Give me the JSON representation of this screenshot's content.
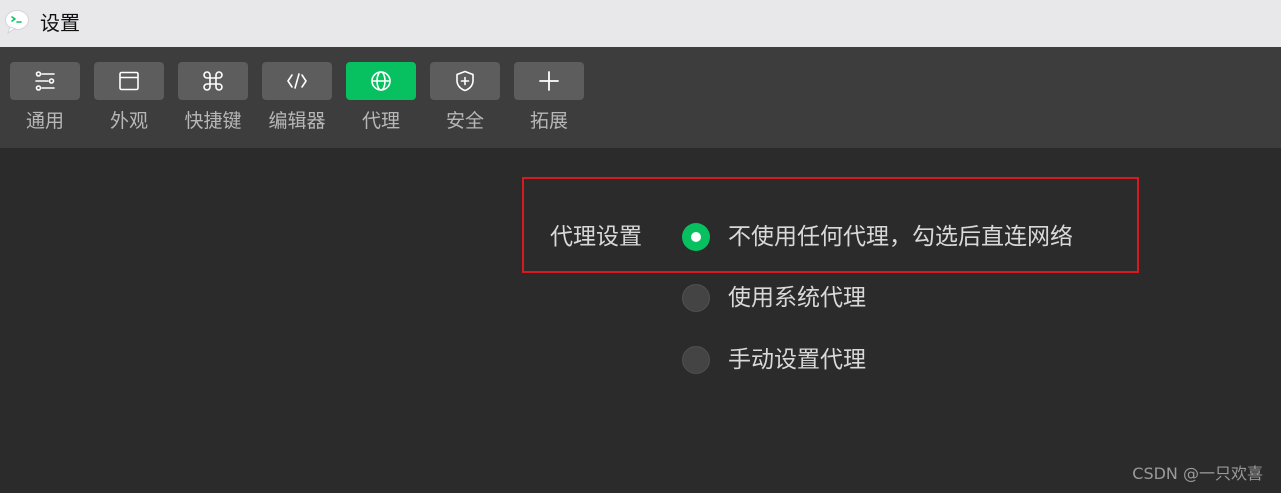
{
  "window": {
    "title": "设置",
    "logo_icon": "wechat-devtools-logo"
  },
  "toolbar": {
    "active_color": "#07c160",
    "tabs": [
      {
        "label": "通用",
        "icon": "sliders-icon"
      },
      {
        "label": "外观",
        "icon": "window-icon"
      },
      {
        "label": "快捷键",
        "icon": "command-icon"
      },
      {
        "label": "编辑器",
        "icon": "code-icon"
      },
      {
        "label": "代理",
        "icon": "globe-icon",
        "active": true
      },
      {
        "label": "安全",
        "icon": "shield-plus-icon"
      },
      {
        "label": "拓展",
        "icon": "plus-icon"
      }
    ]
  },
  "proxy_settings": {
    "label": "代理设置",
    "options": [
      {
        "label": "不使用任何代理，勾选后直连网络",
        "selected": true
      },
      {
        "label": "使用系统代理",
        "selected": false
      },
      {
        "label": "手动设置代理",
        "selected": false
      }
    ],
    "highlight_color": "#d71920"
  },
  "watermark": "CSDN @一只欢喜"
}
